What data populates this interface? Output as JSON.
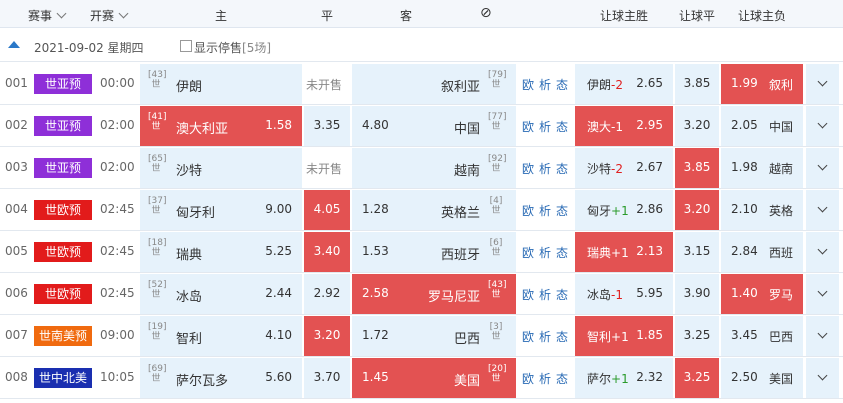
{
  "header": {
    "col_event": "赛事",
    "col_kickoff": "开赛",
    "col_home": "主",
    "col_draw": "平",
    "col_away": "客",
    "col_stop": "⊘",
    "col_hc_home": "让球主胜",
    "col_hc_draw": "让球平",
    "col_hc_away": "让球主负"
  },
  "date_row": {
    "date": "2021-09-02 星期四",
    "show_stopped": "显示停售",
    "stopped_count": "[5场]"
  },
  "links": [
    "欧",
    "析",
    "态"
  ],
  "not_on_sale": "未开售",
  "matches": [
    {
      "no": "001",
      "league": "世亚预",
      "league_color": "#8e2fd8",
      "time": "00:00",
      "home_rank": "43",
      "home_tag": "世",
      "home": "伊朗",
      "home_odd": "",
      "draw_odd": "",
      "away_odd": "",
      "away": "叙利亚",
      "away_rank": "79",
      "away_tag": "世",
      "on_sale": false,
      "hc_team": "伊朗",
      "hc_line": "-2",
      "hc_home": "2.65",
      "hc_draw": "3.85",
      "hc_away": "1.99",
      "hc_away_team": "叙利",
      "hl": "ha"
    },
    {
      "no": "002",
      "league": "世亚预",
      "league_color": "#8e2fd8",
      "time": "02:00",
      "home_rank": "41",
      "home_tag": "世",
      "home": "澳大利亚",
      "home_odd": "1.58",
      "draw_odd": "3.35",
      "away_odd": "4.80",
      "away": "中国",
      "away_rank": "77",
      "away_tag": "世",
      "on_sale": true,
      "hl1": "home",
      "hc_team": "澳大",
      "hc_line": "-1",
      "hc_home": "2.95",
      "hc_draw": "3.20",
      "hc_away": "2.05",
      "hc_away_team": "中国",
      "hl": "hc"
    },
    {
      "no": "003",
      "league": "世亚预",
      "league_color": "#8e2fd8",
      "time": "02:00",
      "home_rank": "65",
      "home_tag": "世",
      "home": "沙特",
      "home_odd": "",
      "draw_odd": "",
      "away_odd": "",
      "away": "越南",
      "away_rank": "92",
      "away_tag": "世",
      "on_sale": false,
      "hc_team": "沙特",
      "hc_line": "-2",
      "hc_home": "2.67",
      "hc_draw": "3.85",
      "hc_away": "1.98",
      "hc_away_team": "越南",
      "hl": "hd"
    },
    {
      "no": "004",
      "league": "世欧预",
      "league_color": "#e21b1b",
      "time": "02:45",
      "home_rank": "37",
      "home_tag": "世",
      "home": "匈牙利",
      "home_odd": "9.00",
      "draw_odd": "4.05",
      "away_odd": "1.28",
      "away": "英格兰",
      "away_rank": "4",
      "away_tag": "世",
      "on_sale": true,
      "hl1": "draw",
      "hc_team": "匈牙",
      "hc_line": "+1",
      "hc_home": "2.86",
      "hc_draw": "3.20",
      "hc_away": "2.10",
      "hc_away_team": "英格",
      "hl": "hd"
    },
    {
      "no": "005",
      "league": "世欧预",
      "league_color": "#e21b1b",
      "time": "02:45",
      "home_rank": "18",
      "home_tag": "世",
      "home": "瑞典",
      "home_odd": "5.25",
      "draw_odd": "3.40",
      "away_odd": "1.53",
      "away": "西班牙",
      "away_rank": "6",
      "away_tag": "世",
      "on_sale": true,
      "hl1": "draw",
      "hc_team": "瑞典",
      "hc_line": "+1",
      "hc_home": "2.13",
      "hc_draw": "3.15",
      "hc_away": "2.84",
      "hc_away_team": "西班",
      "hl": "hc"
    },
    {
      "no": "006",
      "league": "世欧预",
      "league_color": "#e21b1b",
      "time": "02:45",
      "home_rank": "52",
      "home_tag": "世",
      "home": "冰岛",
      "home_odd": "2.44",
      "draw_odd": "2.92",
      "away_odd": "2.58",
      "away": "罗马尼亚",
      "away_rank": "43",
      "away_tag": "世",
      "on_sale": true,
      "hl1": "away",
      "hc_team": "冰岛",
      "hc_line": "-1",
      "hc_home": "5.95",
      "hc_draw": "3.90",
      "hc_away": "1.40",
      "hc_away_team": "罗马",
      "hl": "ha"
    },
    {
      "no": "007",
      "league": "世南美预",
      "league_color": "#f06a0f",
      "time": "09:00",
      "home_rank": "19",
      "home_tag": "世",
      "home": "智利",
      "home_odd": "4.10",
      "draw_odd": "3.20",
      "away_odd": "1.72",
      "away": "巴西",
      "away_rank": "3",
      "away_tag": "世",
      "on_sale": true,
      "hl1": "draw",
      "hc_team": "智利",
      "hc_line": "+1",
      "hc_home": "1.85",
      "hc_draw": "3.25",
      "hc_away": "3.45",
      "hc_away_team": "巴西",
      "hl": "hc"
    },
    {
      "no": "008",
      "league": "世中北美",
      "league_color": "#1a2fb0",
      "time": "10:05",
      "home_rank": "69",
      "home_tag": "世",
      "home": "萨尔瓦多",
      "home_odd": "5.60",
      "draw_odd": "3.70",
      "away_odd": "1.45",
      "away": "美国",
      "away_rank": "20",
      "away_tag": "世",
      "on_sale": true,
      "hl1": "away",
      "hc_team": "萨尔",
      "hc_line": "+1",
      "hc_home": "2.32",
      "hc_draw": "3.25",
      "hc_away": "2.50",
      "hc_away_team": "美国",
      "hl": "hd"
    }
  ]
}
